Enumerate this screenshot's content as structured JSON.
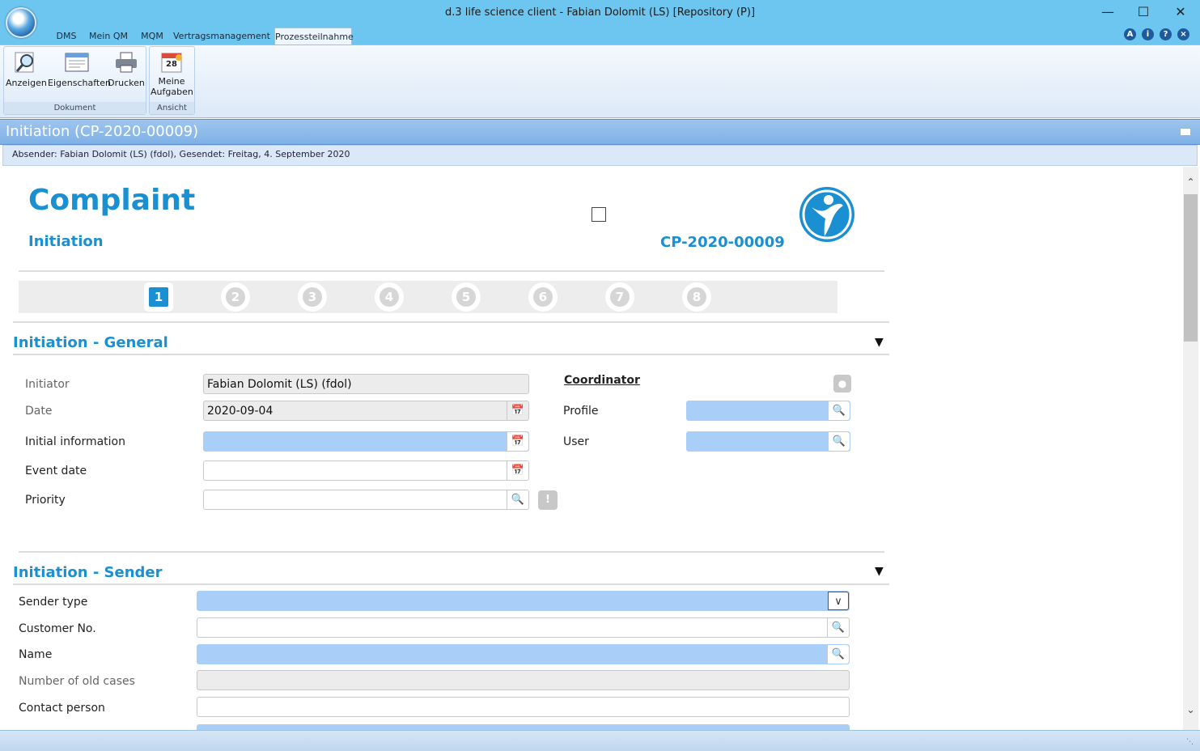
{
  "window": {
    "title": "d.3 life science client - Fabian Dolomit (LS) [Repository (P)]"
  },
  "ribbon": {
    "tabs": [
      "DMS",
      "Mein QM",
      "MQM",
      "Vertragsmanagement",
      "Prozessteilnahme"
    ],
    "active_tab": "Prozessteilnahme",
    "groups": [
      {
        "label": "Dokument",
        "buttons": [
          "Anzeigen",
          "Eigenschaften",
          "Drucken"
        ]
      },
      {
        "label": "Ansicht",
        "buttons": [
          "Meine Aufgaben"
        ]
      }
    ],
    "calendar_day": "28"
  },
  "document": {
    "title": "Initiation (CP-2020-00009)",
    "info": "Absender: Fabian Dolomit (LS) (fdol), Gesendet: Freitag, 4. September 2020"
  },
  "form": {
    "heading": "Complaint",
    "subheading": "Initiation",
    "case_id": "CP-2020-00009",
    "steps": [
      "1",
      "2",
      "3",
      "4",
      "5",
      "6",
      "7",
      "8"
    ],
    "active_step": "1",
    "general": {
      "title": "Initiation - General",
      "initiator_label": "Initiator",
      "initiator_value": "Fabian Dolomit (LS) (fdol)",
      "date_label": "Date",
      "date_value": "2020-09-04",
      "initial_info_label": "Initial information",
      "event_date_label": "Event date",
      "priority_label": "Priority",
      "coordinator_label": "Coordinator",
      "profile_label": "Profile",
      "user_label": "User"
    },
    "sender": {
      "title": "Initiation - Sender",
      "sender_type_label": "Sender type",
      "customer_no_label": "Customer No.",
      "name_label": "Name",
      "old_cases_label": "Number of old cases",
      "contact_label": "Contact person"
    }
  },
  "colors": {
    "accent": "#1a8fd1",
    "required_field": "#a9cff8",
    "titlebar": "#6cc6f0"
  }
}
